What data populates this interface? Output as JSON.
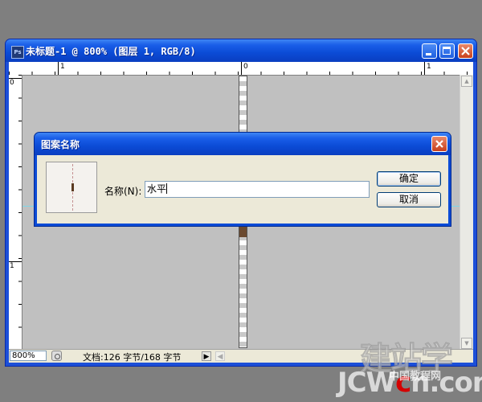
{
  "document": {
    "title": "未标题-1 @ 800% (图层 1, RGB/8)",
    "app_icon": "Ps",
    "ruler": {
      "h_labels": [
        "1",
        "0",
        "1"
      ],
      "v_labels": [
        "0",
        "1"
      ]
    },
    "status": {
      "zoom": "800%",
      "doc_info": "文档:126 字节/168 字节",
      "arrow": "▶",
      "scroll_left": "◀"
    }
  },
  "dialog": {
    "title": "图案名称",
    "name_label": "名称(N):",
    "name_value": "水平",
    "ok_label": "确定",
    "cancel_label": "取消"
  },
  "watermark": {
    "big": "建站学",
    "cn": "中国教程网",
    "url_prefix": "JCW",
    "url_red": "c",
    "url_suffix": "n.com"
  },
  "colors": {
    "titlebar": "#0b4bd6",
    "canvas_bg": "#c0c0c0",
    "desktop": "#7f7f7f",
    "guide": "#7fd6e8",
    "pattern_brown": "#6b4a30"
  },
  "icons": [
    "photoshop-app-icon",
    "minimize-icon",
    "maximize-icon",
    "close-icon",
    "status-menu-icon"
  ]
}
